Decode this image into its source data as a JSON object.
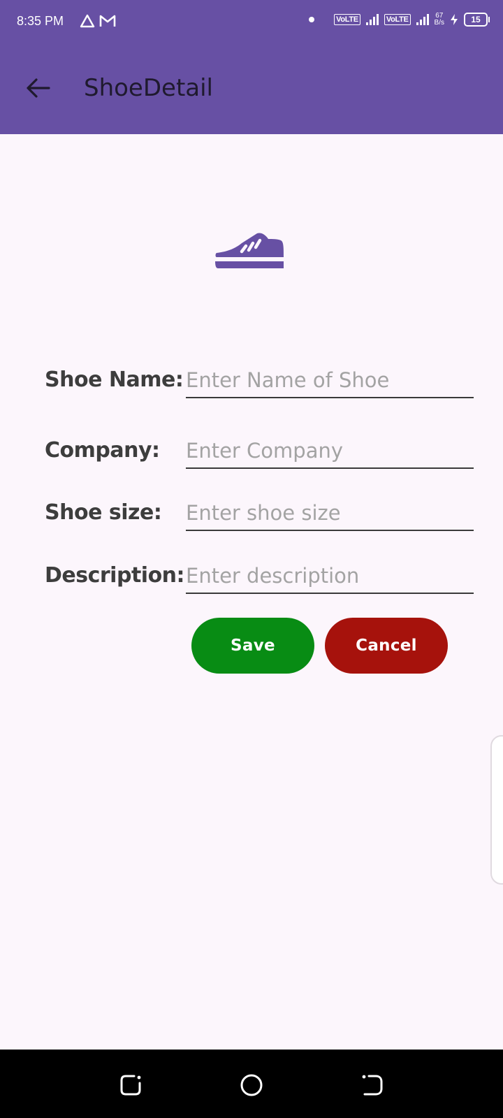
{
  "status_bar": {
    "time": "8:35 PM",
    "network_label_1": "VoLTE",
    "network_label_2": "VoLTE",
    "speed_value": "67",
    "speed_unit": "B/s",
    "battery_level": "15"
  },
  "app_bar": {
    "title": "ShoeDetail"
  },
  "form": {
    "name": {
      "label": "Shoe Name:",
      "placeholder": "Enter Name of Shoe",
      "value": ""
    },
    "company": {
      "label": "Company:",
      "placeholder": "Enter Company",
      "value": ""
    },
    "size": {
      "label": "Shoe size:",
      "placeholder": "Enter shoe size",
      "value": ""
    },
    "description": {
      "label": "Description:",
      "placeholder": "Enter description",
      "value": ""
    }
  },
  "actions": {
    "save_label": "Save",
    "cancel_label": "Cancel"
  },
  "icons": {
    "back": "arrow-left-icon",
    "hero": "shoe-icon",
    "nav_recent": "recent-apps-icon",
    "nav_home": "home-icon",
    "nav_back": "back-icon"
  },
  "colors": {
    "primary": "#6750a4",
    "save": "#088c14",
    "cancel": "#a6120c",
    "background": "#fcf6fc"
  }
}
